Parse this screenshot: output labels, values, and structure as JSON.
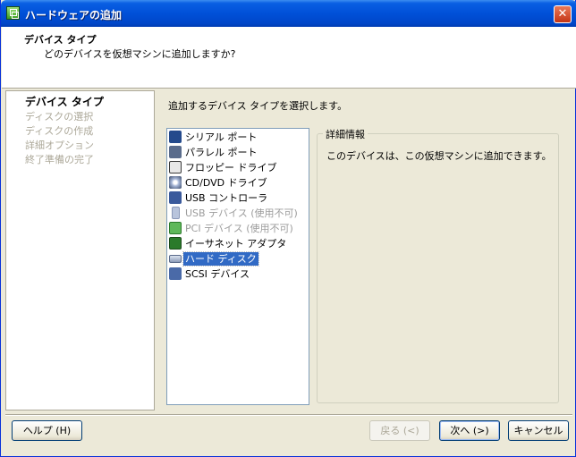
{
  "window": {
    "title": "ハードウェアの追加",
    "close_symbol": "✕"
  },
  "header": {
    "title": "デバイス タイプ",
    "subtitle": "どのデバイスを仮想マシンに追加しますか?"
  },
  "steps": [
    {
      "label": "デバイス タイプ",
      "active": true
    },
    {
      "label": "ディスクの選択",
      "active": false
    },
    {
      "label": "ディスクの作成",
      "active": false
    },
    {
      "label": "詳細オプション",
      "active": false
    },
    {
      "label": "終了準備の完了",
      "active": false
    }
  ],
  "main": {
    "instruction": "追加するデバイス タイプを選択します。",
    "devices": [
      {
        "label": "シリアル ポート",
        "icon": "serial-port-icon",
        "enabled": true,
        "selected": false
      },
      {
        "label": "パラレル ポート",
        "icon": "parallel-port-icon",
        "enabled": true,
        "selected": false
      },
      {
        "label": "フロッピー ドライブ",
        "icon": "floppy-drive-icon",
        "enabled": true,
        "selected": false
      },
      {
        "label": "CD/DVD ドライブ",
        "icon": "cd-dvd-drive-icon",
        "enabled": true,
        "selected": false
      },
      {
        "label": "USB コントローラ",
        "icon": "usb-controller-icon",
        "enabled": true,
        "selected": false
      },
      {
        "label": "USB デバイス (使用不可)",
        "icon": "usb-device-icon",
        "enabled": false,
        "selected": false
      },
      {
        "label": "PCI デバイス (使用不可)",
        "icon": "pci-device-icon",
        "enabled": false,
        "selected": false
      },
      {
        "label": "イーサネット アダプタ",
        "icon": "ethernet-adapter-icon",
        "enabled": true,
        "selected": false
      },
      {
        "label": "ハード ディスク",
        "icon": "hard-disk-icon",
        "enabled": true,
        "selected": true
      },
      {
        "label": "SCSI デバイス",
        "icon": "scsi-device-icon",
        "enabled": true,
        "selected": false
      }
    ],
    "info": {
      "title": "詳細情報",
      "text": "このデバイスは、この仮想マシンに追加できます。"
    }
  },
  "buttons": {
    "help": "ヘルプ (H)",
    "back": "戻る (<)",
    "next": "次へ (>)",
    "cancel": "キャンセル"
  }
}
